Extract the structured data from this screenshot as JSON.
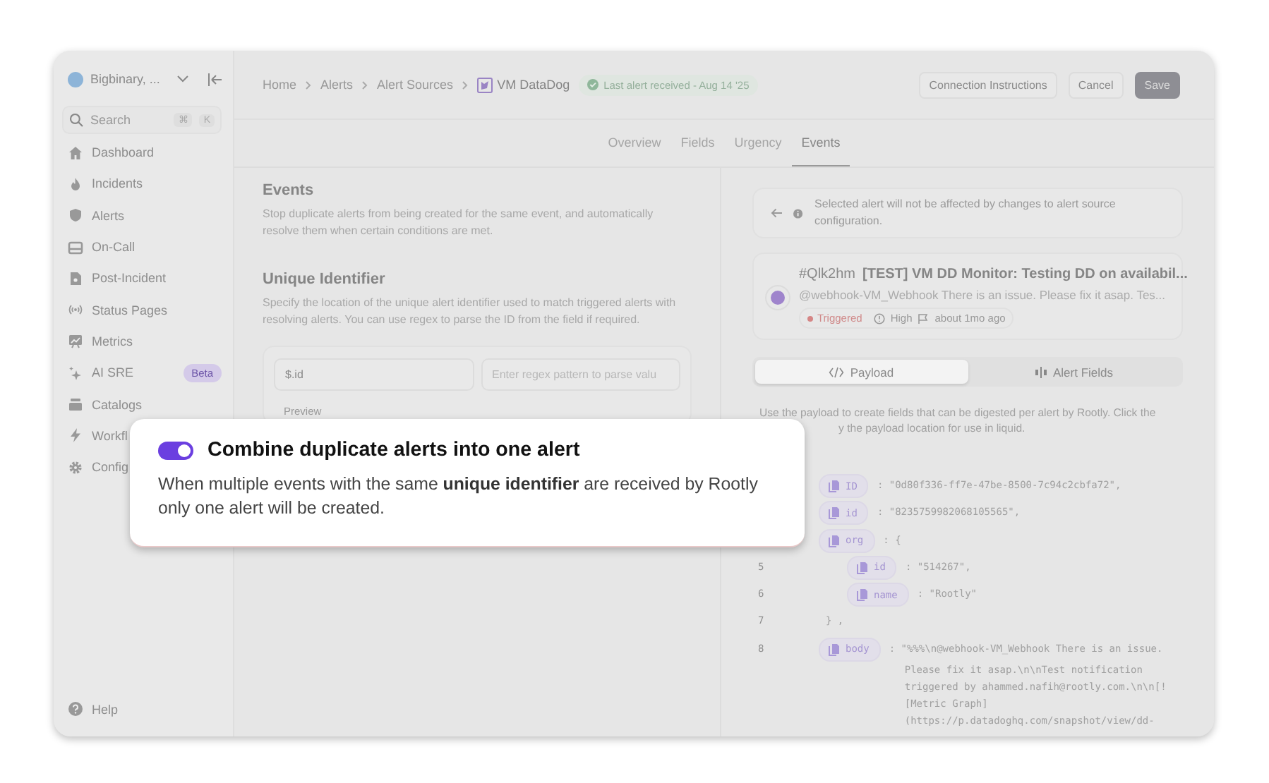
{
  "sidebar": {
    "workspace": "Bigbinary, ...",
    "search": {
      "placeholder": "Search",
      "keys": [
        "⌘",
        "K"
      ]
    },
    "items": [
      {
        "label": "Dashboard"
      },
      {
        "label": "Incidents"
      },
      {
        "label": "Alerts"
      },
      {
        "label": "On-Call"
      },
      {
        "label": "Post-Incident"
      },
      {
        "label": "Status Pages"
      },
      {
        "label": "Metrics"
      },
      {
        "label": "AI SRE",
        "badge": "Beta"
      },
      {
        "label": "Catalogs"
      },
      {
        "label": "Workfl"
      },
      {
        "label": "Config"
      }
    ],
    "help": "Help"
  },
  "breadcrumbs": [
    "Home",
    "Alerts",
    "Alert Sources",
    "VM DataDog"
  ],
  "status_badge": "Last alert received - Aug 14 '25",
  "header_buttons": [
    {
      "label": "Connection Instructions",
      "kind": "secondary"
    },
    {
      "label": "Cancel",
      "kind": "secondary"
    },
    {
      "label": "Save",
      "kind": "primary"
    }
  ],
  "tabs": [
    {
      "label": "Overview",
      "selected": false
    },
    {
      "label": "Fields",
      "selected": false
    },
    {
      "label": "Urgency",
      "selected": false
    },
    {
      "label": "Events",
      "selected": true
    }
  ],
  "events": {
    "title": "Events",
    "description": "Stop duplicate alerts from being created for the same event, and automatically resolve them when certain conditions are met.",
    "unique_identifier": {
      "title": "Unique Identifier",
      "description": "Specify the location of the unique alert identifier used to match triggered alerts with resolving alerts. You can use regex to parse the ID from the field if required.",
      "value": "$.id",
      "regex_placeholder": "Enter regex pattern to parse valu",
      "preview": "Preview"
    }
  },
  "notice": "Selected alert will not be affected by changes to alert source configuration.",
  "alert": {
    "id": "#Qlk2hm",
    "title": "[TEST] VM DD Monitor: Testing DD on availabil...",
    "body": "@webhook-VM_Webhook There is an issue. Please fix it asap. Tes...",
    "status": "Triggered",
    "urgency": "High",
    "time": "about 1mo ago"
  },
  "view_tabs": [
    {
      "label": "Payload",
      "selected": true
    },
    {
      "label": "Alert Fields",
      "selected": false
    }
  ],
  "payload_hint": [
    "Use the payload to create fields that can be digested per alert by Rootly. Click the",
    "y the payload location for use in liquid."
  ],
  "code": [
    {
      "key": "ID",
      "value": ": \"0d80f336-ff7e-47be-8500-7c94c2cbfa72\","
    },
    {
      "key": "id",
      "value": ": \"8235759982068105565\","
    },
    {
      "key": "org",
      "value": ": {",
      "children": [
        {
          "num": "5",
          "key": "id",
          "value": ": \"514267\","
        },
        {
          "num": "6",
          "key": "name",
          "value": ": \"Rootly\""
        }
      ],
      "closing": {
        "num": "7",
        "text": "} ,"
      }
    },
    {
      "num": "8",
      "key": "body",
      "value": ": \"%%%\\n@webhook-VM_Webhook There is an issue.",
      "more": [
        "Please fix it asap.\\n\\nTest notification",
        "triggered by ahammed.nafih@rootly.com.\\n\\n[!",
        "[Metric Graph]",
        "(https://p.datadoghq.com/snapshot/view/dd-"
      ]
    }
  ],
  "popup": {
    "toggle_on": true,
    "title": "Combine duplicate alerts into one alert",
    "text": "When multiple events with the same **unique identifier** are received by Rootly only one alert will be created."
  }
}
